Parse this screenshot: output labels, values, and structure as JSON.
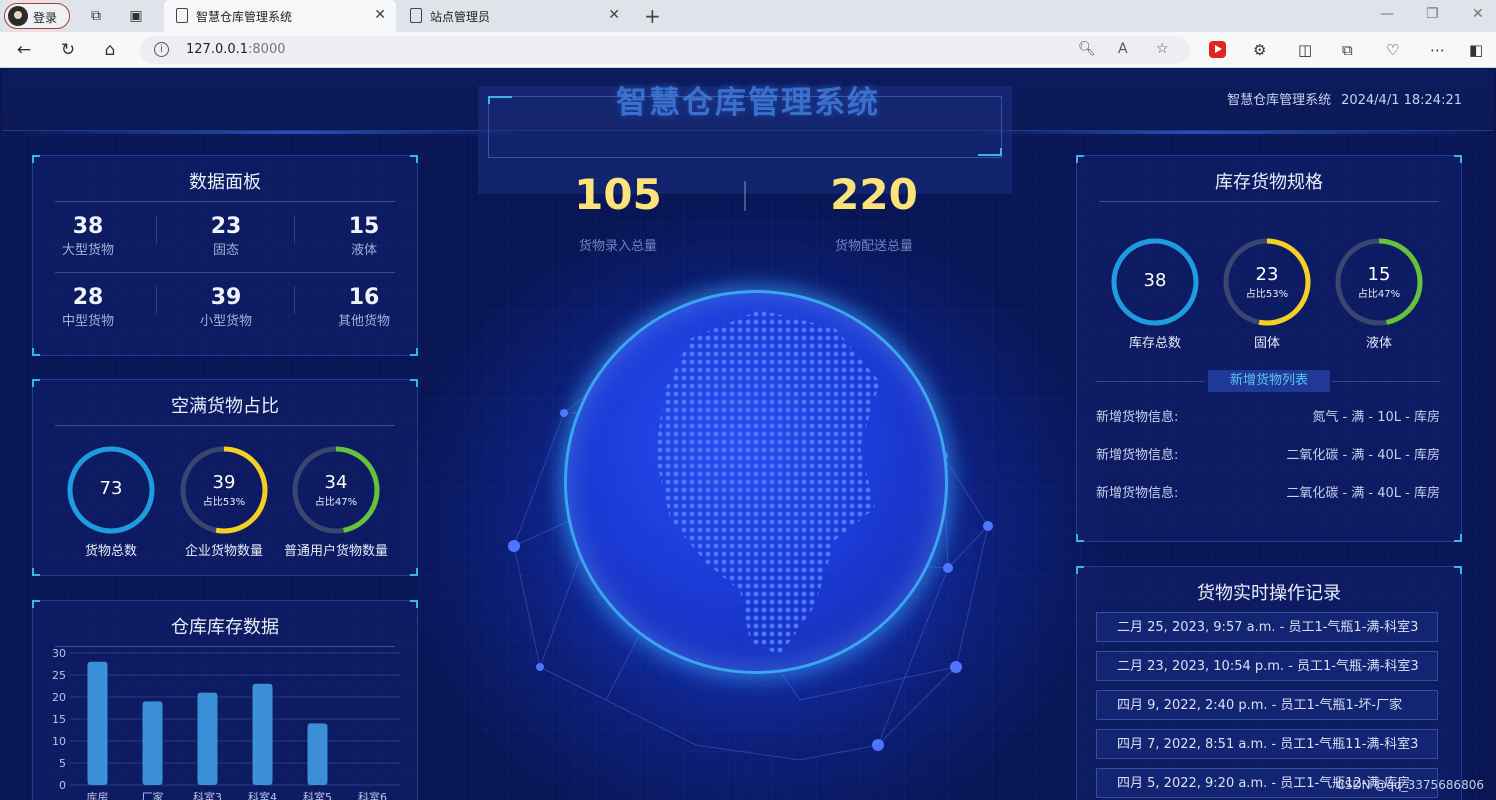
{
  "browser": {
    "profile_label": "登录",
    "tabs": [
      {
        "title": "智慧仓库管理系统",
        "active": true
      },
      {
        "title": "站点管理员",
        "active": false
      }
    ],
    "url_host": "127.0.0.1",
    "url_port": ":8000"
  },
  "header": {
    "title": "智慧仓库管理系统",
    "system_name": "智慧仓库管理系统",
    "datetime": "2024/4/1 18:24:21"
  },
  "data_panel": {
    "title": "数据面板",
    "stats": [
      {
        "value": "38",
        "label": "大型货物"
      },
      {
        "value": "23",
        "label": "固态"
      },
      {
        "value": "15",
        "label": "液体"
      },
      {
        "value": "28",
        "label": "中型货物"
      },
      {
        "value": "39",
        "label": "小型货物"
      },
      {
        "value": "16",
        "label": "其他货物"
      }
    ]
  },
  "ratio_panel": {
    "title": "空满货物占比",
    "rings": [
      {
        "value": "73",
        "sub": "",
        "label": "货物总数",
        "color": "#1f9be0",
        "pct": 1.0
      },
      {
        "value": "39",
        "sub": "占比53%",
        "label": "企业货物数量",
        "color": "#f5d020",
        "pct": 0.53
      },
      {
        "value": "34",
        "sub": "占比47%",
        "label": "普通用户货物数量",
        "color": "#63c33a",
        "pct": 0.47
      }
    ]
  },
  "stock_panel": {
    "title": "仓库库存数据"
  },
  "chart_data": {
    "type": "bar",
    "title": "仓库库存数据",
    "categories": [
      "库房",
      "厂家",
      "科室3",
      "科室4",
      "科室5",
      "科室6"
    ],
    "values": [
      28,
      19,
      21,
      23,
      14,
      0
    ],
    "ylim": [
      0,
      30
    ],
    "yticks": [
      0,
      5,
      10,
      15,
      20,
      25,
      30
    ],
    "xlabel": "",
    "ylabel": "",
    "grid": true,
    "color": "#3a8fd6"
  },
  "kpi": {
    "items": [
      {
        "value": "105",
        "label": "货物录入总量"
      },
      {
        "value": "220",
        "label": "货物配送总量"
      }
    ]
  },
  "spec_panel": {
    "title": "库存货物规格",
    "rings": [
      {
        "value": "38",
        "sub": "",
        "label": "库存总数",
        "color": "#1f9be0",
        "pct": 1.0
      },
      {
        "value": "23",
        "sub": "占比53%",
        "label": "固体",
        "color": "#f5d020",
        "pct": 0.53
      },
      {
        "value": "15",
        "sub": "占比47%",
        "label": "液体",
        "color": "#63c33a",
        "pct": 0.47
      }
    ],
    "new_list_button": "新增货物列表",
    "new_items": [
      {
        "key": "新增货物信息:",
        "value": "氮气 - 满 - 10L - 库房"
      },
      {
        "key": "新增货物信息:",
        "value": "二氧化碳 - 满 - 40L - 库房"
      },
      {
        "key": "新增货物信息:",
        "value": "二氧化碳 - 满 - 40L - 库房"
      }
    ]
  },
  "log_panel": {
    "title": "货物实时操作记录",
    "records": [
      "二月 25, 2023, 9:57 a.m. - 员工1-气瓶1-满-科室3",
      "二月 23, 2023, 10:54 p.m. - 员工1-气瓶-满-科室3",
      "四月 9, 2022, 2:40 p.m. - 员工1-气瓶1-坏-厂家",
      "四月 7, 2022, 8:51 a.m. - 员工1-气瓶11-满-科室3",
      "四月 5, 2022, 9:20 a.m. - 员工1-气瓶12-满-库房"
    ]
  },
  "watermark": "CSDN @qq_3375686806"
}
